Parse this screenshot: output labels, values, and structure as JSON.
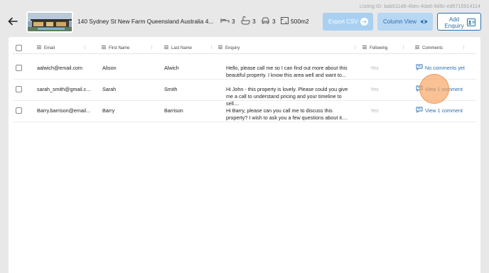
{
  "listing_id": "Listing ID: bab511d6-4bec-4da6-9d9c-ed5715914114",
  "header": {
    "address": "140 Sydney St New Farm Queensland Australia 4...",
    "beds": "3",
    "baths": "3",
    "cars": "3",
    "area": "500m2",
    "icons": [
      "back-arrow-icon",
      "bed-icon",
      "bath-icon",
      "car-icon",
      "area-icon"
    ]
  },
  "buttons": {
    "export_csv": "Export CSV",
    "column_view": "Column View",
    "add_enquiry_line1": "Add",
    "add_enquiry_line2": "Enquiry"
  },
  "table": {
    "columns": [
      "Email",
      "First Name",
      "Last Name",
      "Enquiry",
      "Following",
      "Comments"
    ],
    "rows": [
      {
        "email": "aalwich@email.com",
        "first_name": "Alison",
        "last_name": "Alwich",
        "enquiry_line1": "Hello, please call me so I can find out more about this",
        "enquiry_line2": "beautiful property. I know this area well and want to...",
        "following": "Yes",
        "comments": "No comments yet"
      },
      {
        "email": "sarah_smith@gmail.c...",
        "first_name": "Sarah",
        "last_name": "Smith",
        "enquiry_line1": "Hi John - this property is lovely. Please could you give",
        "enquiry_line2": "me a call to understand pricing and your timeline to sell....",
        "following": "Yes",
        "comments": "View 1 comment"
      },
      {
        "email": "Barry.barrison@email...",
        "first_name": "Barry",
        "last_name": "Barrison",
        "enquiry_line1": "Hi Barry, please can you call me to discuss this",
        "enquiry_line2": "property? I wish to ask you a few questions about it....",
        "following": "Yes",
        "comments": "View 1 comment"
      }
    ]
  },
  "colors": {
    "accent": "#2a6fb0",
    "export_button": "#a9d0f0",
    "column_button": "#b7d7f2",
    "click_marker": "#f6a05a"
  }
}
